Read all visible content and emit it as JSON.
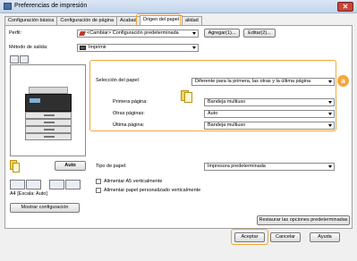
{
  "window": {
    "title": "Preferencias de impresión",
    "close_label": "✕"
  },
  "tabs": [
    {
      "label": "Configuración básica",
      "active": false
    },
    {
      "label": "Configuración de página",
      "active": false
    },
    {
      "label": "Acabad",
      "active": false
    },
    {
      "label": "Origen del papel",
      "active": true
    },
    {
      "label": "alidad",
      "active": false
    }
  ],
  "profile": {
    "label": "Perfil:",
    "value": "<Cambiar> Configuración predeterminada",
    "add_label": "Agregar(1)...",
    "edit_label": "Editar(2)..."
  },
  "output": {
    "label": "Método de salida:",
    "value": "Imprimir"
  },
  "preview": {
    "auto_label": "Auto",
    "scale_text": "A4 [Escala: Auto]",
    "show_config_label": "Mostrar configuración"
  },
  "paper_selection": {
    "label": "Selección del papel:",
    "value": "Diferente para la primera, las otras y la última página",
    "first_page_label": "Primera página:",
    "first_page_value": "Bandeja multiuso",
    "other_pages_label": "Otras páginas:",
    "other_pages_value": "Auto",
    "last_page_label": "Última página:",
    "last_page_value": "Bandeja multiuso"
  },
  "badge": {
    "text": "a"
  },
  "paper_type": {
    "label": "Tipo de papel:",
    "value": "Impresora predeterminada"
  },
  "checkboxes": [
    {
      "label": "Alimentar A5 verticalmente",
      "checked": false
    },
    {
      "label": "Alimentar papel personalizado verticalmente",
      "checked": false
    }
  ],
  "restore_label": "Restaurar las opciones predeterminadas",
  "footer": {
    "ok_label": "Aceptar",
    "cancel_label": "Cancelar",
    "help_label": "Ayuda"
  },
  "colors": {
    "highlight": "#f2a83a",
    "titlebar": "#c3d5ec"
  }
}
